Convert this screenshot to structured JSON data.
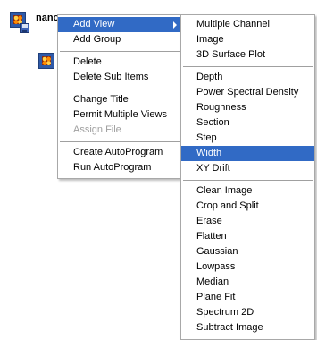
{
  "tree": {
    "node_label": "nano"
  },
  "context_menu": {
    "groups": [
      [
        {
          "label": "Add View",
          "submenu": true,
          "highlighted": true
        },
        {
          "label": "Add Group"
        }
      ],
      [
        {
          "label": "Delete"
        },
        {
          "label": "Delete Sub Items"
        }
      ],
      [
        {
          "label": "Change Title"
        },
        {
          "label": "Permit Multiple Views"
        },
        {
          "label": "Assign File",
          "disabled": true
        }
      ],
      [
        {
          "label": "Create AutoProgram"
        },
        {
          "label": "Run AutoProgram"
        }
      ]
    ]
  },
  "submenu": {
    "groups": [
      [
        {
          "label": "Multiple Channel"
        },
        {
          "label": "Image"
        },
        {
          "label": "3D Surface Plot"
        }
      ],
      [
        {
          "label": "Depth"
        },
        {
          "label": "Power Spectral Density"
        },
        {
          "label": "Roughness"
        },
        {
          "label": "Section"
        },
        {
          "label": "Step"
        },
        {
          "label": "Width",
          "highlighted": true
        },
        {
          "label": "XY Drift"
        }
      ],
      [
        {
          "label": "Clean Image"
        },
        {
          "label": "Crop and Split"
        },
        {
          "label": "Erase"
        },
        {
          "label": "Flatten"
        },
        {
          "label": "Gaussian"
        },
        {
          "label": "Lowpass"
        },
        {
          "label": "Median"
        },
        {
          "label": "Plane Fit"
        },
        {
          "label": "Spectrum 2D"
        },
        {
          "label": "Subtract Image"
        }
      ]
    ]
  },
  "colors": {
    "highlight": "#316ac5",
    "disabled_text": "#a0a0a0"
  }
}
